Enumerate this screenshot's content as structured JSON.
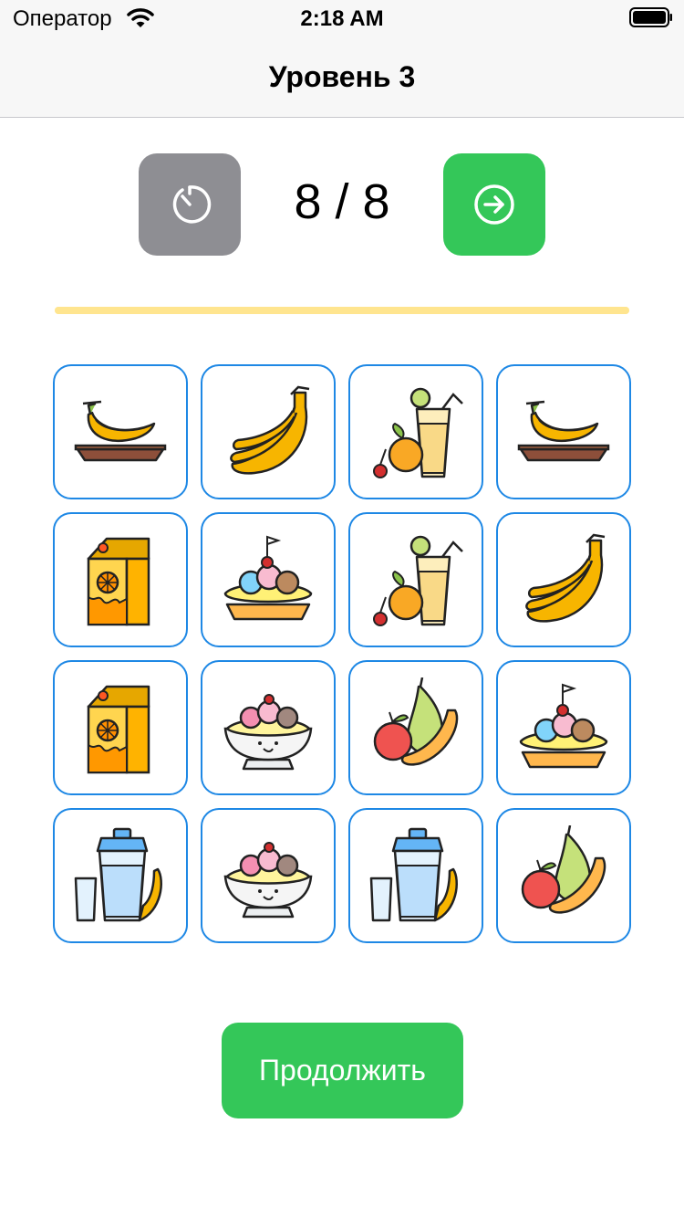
{
  "status_bar": {
    "carrier": "Оператор",
    "time": "2:18 AM"
  },
  "nav": {
    "title": "Уровень 3"
  },
  "toolbar": {
    "counter": "8 / 8",
    "timer_icon": "timer-icon",
    "next_icon": "arrow-right-circle-icon"
  },
  "progress": {
    "fraction": 1.0
  },
  "cards": [
    {
      "icon": "banana-plate"
    },
    {
      "icon": "banana-bunch"
    },
    {
      "icon": "juice-orange"
    },
    {
      "icon": "banana-plate"
    },
    {
      "icon": "juice-carton"
    },
    {
      "icon": "ice-cream-boat"
    },
    {
      "icon": "juice-orange"
    },
    {
      "icon": "banana-bunch"
    },
    {
      "icon": "juice-carton"
    },
    {
      "icon": "banana-split-bowl"
    },
    {
      "icon": "fruit-mix"
    },
    {
      "icon": "ice-cream-boat"
    },
    {
      "icon": "smoothie-jar"
    },
    {
      "icon": "banana-split-bowl"
    },
    {
      "icon": "smoothie-jar"
    },
    {
      "icon": "fruit-mix"
    }
  ],
  "continue_button": {
    "label": "Продолжить"
  },
  "colors": {
    "accent_green": "#34c759",
    "timer_gray": "#8e8e93",
    "card_border": "#1e88e5",
    "progress": "#ffe58f"
  }
}
